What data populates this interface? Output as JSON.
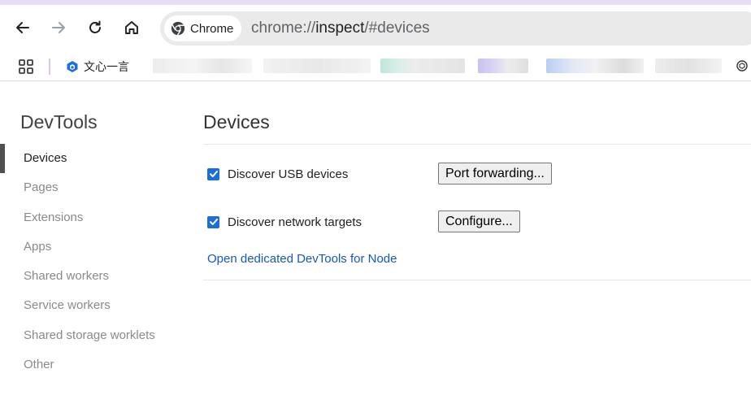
{
  "browser": {
    "chip_label": "Chrome",
    "url_scheme": "chrome://",
    "url_host": "inspect",
    "url_path": "/#devices"
  },
  "bookmarks": {
    "first_label": "文心一言"
  },
  "sidebar": {
    "title": "DevTools",
    "items": [
      {
        "label": "Devices",
        "active": true
      },
      {
        "label": "Pages",
        "active": false
      },
      {
        "label": "Extensions",
        "active": false
      },
      {
        "label": "Apps",
        "active": false
      },
      {
        "label": "Shared workers",
        "active": false
      },
      {
        "label": "Service workers",
        "active": false
      },
      {
        "label": "Shared storage worklets",
        "active": false
      },
      {
        "label": "Other",
        "active": false
      }
    ]
  },
  "main": {
    "title": "Devices",
    "usb": {
      "label": "Discover USB devices",
      "checked": true
    },
    "network": {
      "label": "Discover network targets",
      "checked": true
    },
    "port_forwarding_button": "Port forwarding...",
    "configure_button": "Configure...",
    "node_link": "Open dedicated DevTools for Node"
  },
  "colors": {
    "accent": "#1a6ed8",
    "link": "#1558c0",
    "active_indicator": "#505050"
  }
}
